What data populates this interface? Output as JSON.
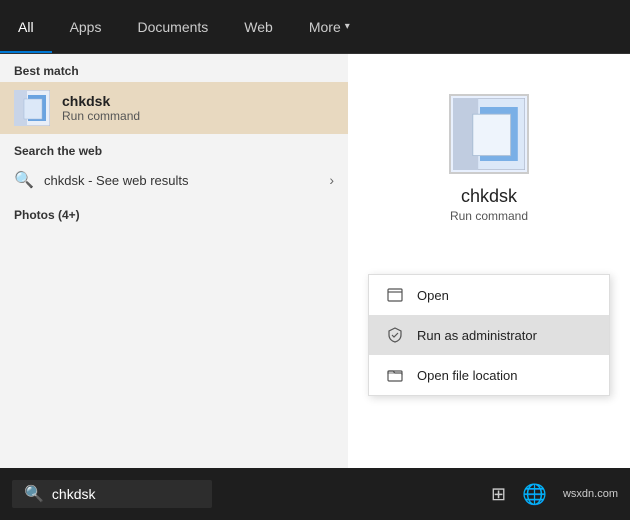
{
  "tabs": {
    "items": [
      {
        "label": "All",
        "active": true
      },
      {
        "label": "Apps",
        "active": false
      },
      {
        "label": "Documents",
        "active": false
      },
      {
        "label": "Web",
        "active": false
      },
      {
        "label": "More",
        "active": false,
        "hasChevron": true
      }
    ]
  },
  "left_panel": {
    "best_match_label": "Best match",
    "best_match": {
      "title": "chkdsk",
      "subtitle": "Run command"
    },
    "web_search_label": "Search the web",
    "web_search": {
      "query": "chkdsk",
      "suffix": " - See web results"
    },
    "photos_label": "Photos (4+)"
  },
  "right_panel": {
    "app_name": "chkdsk",
    "app_subtitle": "Run command",
    "context_menu": {
      "items": [
        {
          "label": "Open",
          "icon": "open-icon"
        },
        {
          "label": "Run as administrator",
          "icon": "shield-icon",
          "hovered": true
        },
        {
          "label": "Open file location",
          "icon": "folder-icon"
        }
      ]
    }
  },
  "taskbar": {
    "search_text": "chkdsk",
    "right_area": "wsxdn.com"
  }
}
